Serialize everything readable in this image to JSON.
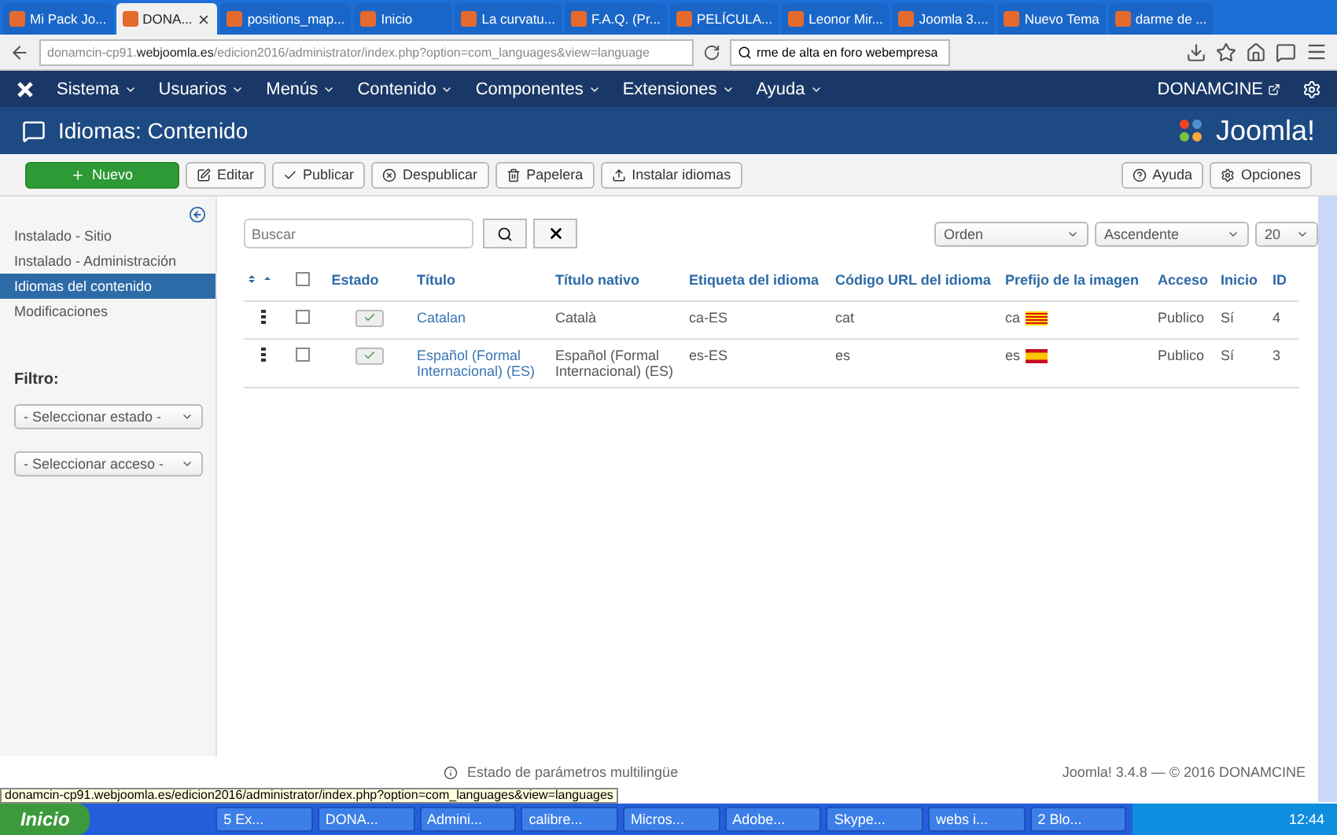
{
  "browser": {
    "tabs": [
      {
        "label": "Mi Pack Jo...",
        "selected": false
      },
      {
        "label": "DONA...",
        "selected": true
      },
      {
        "label": "positions_map...",
        "selected": false
      },
      {
        "label": "Inicio",
        "selected": false
      },
      {
        "label": "La curvatu...",
        "selected": false
      },
      {
        "label": "F.A.Q. (Pr...",
        "selected": false
      },
      {
        "label": "PELÍCULA...",
        "selected": false
      },
      {
        "label": "Leonor Mir...",
        "selected": false
      },
      {
        "label": "Joomla 3....",
        "selected": false
      },
      {
        "label": "Nuevo Tema",
        "selected": false
      },
      {
        "label": "darme de ...",
        "selected": false
      }
    ],
    "url": "donamcin-cp91.**webjoomla.es**/edicion2016/administrator/index.php?option=com_languages&view=language",
    "search": "rme de alta en foro webempresa"
  },
  "nav": {
    "menus": [
      "Sistema",
      "Usuarios",
      "Menús",
      "Contenido",
      "Componentes",
      "Extensiones",
      "Ayuda"
    ],
    "site": "DONAMCINE"
  },
  "header": {
    "title": "Idiomas: Contenido",
    "logo": "Joomla!"
  },
  "toolbar": {
    "buttons": [
      {
        "label": "Nuevo",
        "kind": "primary"
      },
      {
        "label": "Editar",
        "kind": "edit"
      },
      {
        "label": "Publicar",
        "kind": "publish"
      },
      {
        "label": "Despublicar",
        "kind": "unpublish"
      },
      {
        "label": "Papelera",
        "kind": "trash"
      },
      {
        "label": "Instalar idiomas",
        "kind": "install"
      }
    ],
    "right": [
      {
        "label": "Ayuda",
        "kind": "help"
      },
      {
        "label": "Opciones",
        "kind": "options"
      }
    ]
  },
  "sidebar": {
    "items": [
      {
        "label": "Instalado - Sitio",
        "selected": false
      },
      {
        "label": "Instalado - Administración",
        "selected": false
      },
      {
        "label": "Idiomas del contenido",
        "selected": true
      },
      {
        "label": "Modificaciones",
        "selected": false
      }
    ],
    "filter_title": "Filtro:",
    "filters": [
      "- Seleccionar estado -",
      "- Seleccionar acceso -"
    ]
  },
  "search": {
    "placeholder": "Buscar"
  },
  "sort": [
    "Orden",
    "Ascendente",
    "20"
  ],
  "table": {
    "select_all": false,
    "columns": [
      "Estado",
      "Título",
      "Título nativo",
      "Etiqueta del idioma",
      "Código URL del idioma",
      "Prefijo de la imagen",
      "Acceso",
      "Inicio",
      "ID"
    ],
    "rows": [
      {
        "checked": false,
        "published": true,
        "title": "Catalan",
        "native": "Català",
        "tag": "ca-ES",
        "code": "cat",
        "prefix": "ca",
        "access": "Publico",
        "home": "Sí",
        "id": "4"
      },
      {
        "checked": false,
        "published": true,
        "title": "Español (Formal Internacional) (ES)",
        "native": "Español (Formal Internacional) (ES)",
        "tag": "es-ES",
        "code": "es",
        "prefix": "es",
        "access": "Publico",
        "home": "Sí",
        "id": "3"
      }
    ]
  },
  "footer": {
    "status": "Estado de parámetros multilingüe",
    "version": "Joomla! 3.4.8 — © 2016 DONAMCINE"
  },
  "status_url": "donamcin-cp91.webjoomla.es/edicion2016/administrator/index.php?option=com_languages&view=languages",
  "taskbar": {
    "start": "Inicio",
    "tasks": [
      "5 Ex...",
      "DONA...",
      "Admini...",
      "calibre...",
      "Micros...",
      "Adobe...",
      "Skype...",
      "webs i...",
      "2 Blo..."
    ],
    "clock": "12:44"
  }
}
